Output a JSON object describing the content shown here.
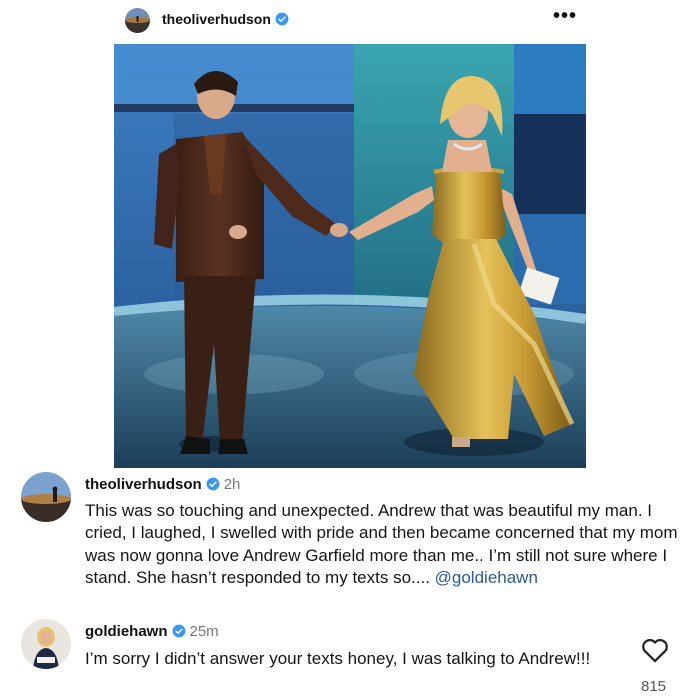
{
  "post": {
    "username": "theoliverhudson",
    "verified_icon": "verified-badge-icon",
    "more_icon": "more-options-icon",
    "more_label": "•••"
  },
  "colors": {
    "verified": "#3897f0",
    "mention": "#2d5a9a",
    "time": "#777777"
  },
  "comments": [
    {
      "username": "theoliverhudson",
      "time": "2h",
      "text_before": "This was so touching and unexpected. Andrew that was beautiful my man. I cried, I laughed, I swelled with pride and then became concerned that my mom was now gonna love Andrew Garfield more than me.. I’m still not sure where I stand. She hasn’t responded to my texts so.... ",
      "mention": "@goldiehawn"
    },
    {
      "username": "goldiehawn",
      "time": "25m",
      "text": "I’m sorry I didn’t answer your texts honey, I was talking to Andrew!!!",
      "likes": "815",
      "like_icon": "heart-icon"
    }
  ]
}
